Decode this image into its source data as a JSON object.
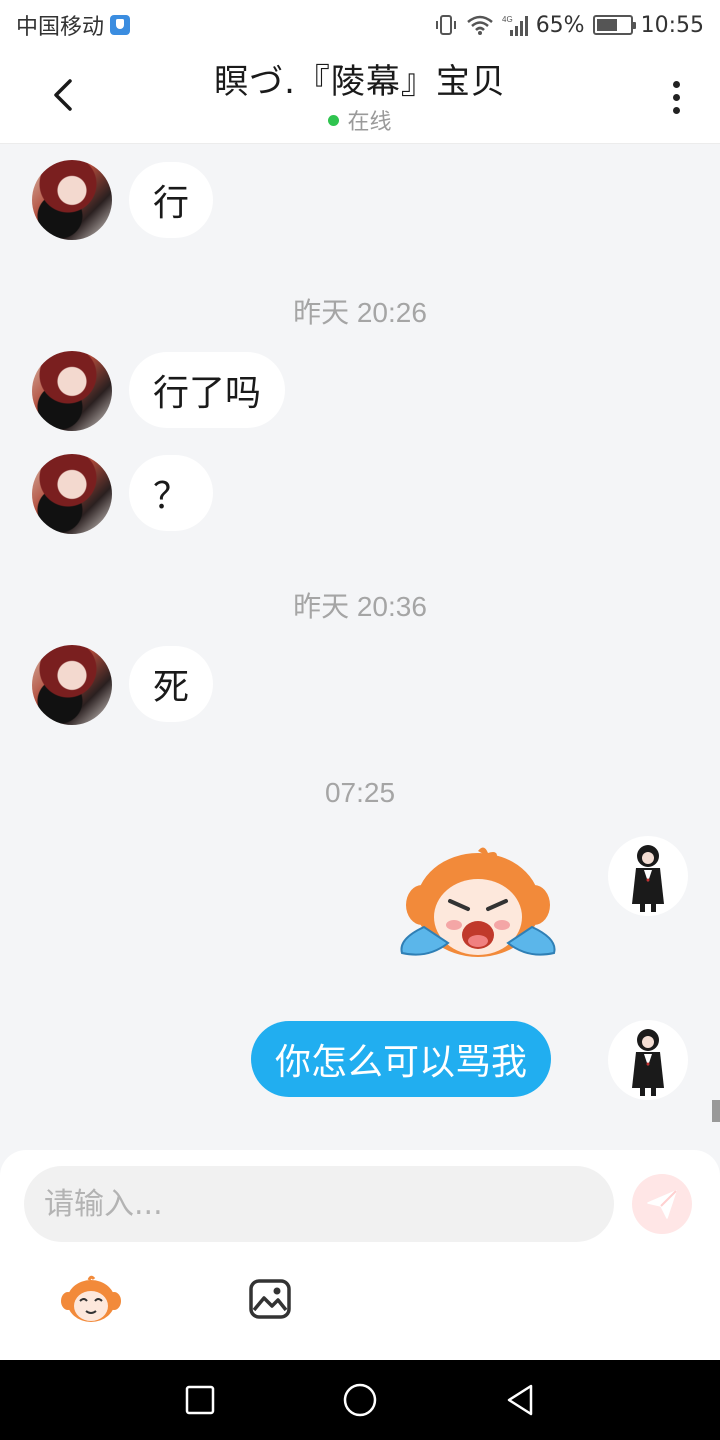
{
  "status_bar": {
    "carrier": "中国移动",
    "network": "4G",
    "battery": "65%",
    "battery_level": 0.65,
    "time": "10:55"
  },
  "header": {
    "back_icon": "chevron-left-icon",
    "title": "瞑づ.『陵幕』宝贝",
    "status": "在线",
    "status_color": "#2fc44f",
    "more_icon": "more-vertical-icon"
  },
  "messages": [
    {
      "kind": "text",
      "direction": "in",
      "text": "行"
    },
    {
      "kind": "timestamp",
      "text": "昨天 20:26"
    },
    {
      "kind": "text",
      "direction": "in",
      "text": "行了吗"
    },
    {
      "kind": "text",
      "direction": "in",
      "text": "？"
    },
    {
      "kind": "timestamp",
      "text": "昨天 20:36"
    },
    {
      "kind": "text",
      "direction": "in",
      "text": "死"
    },
    {
      "kind": "timestamp",
      "text": "07:25"
    },
    {
      "kind": "sticker",
      "direction": "out",
      "sticker": "crying-monkey-sticker"
    },
    {
      "kind": "text",
      "direction": "out",
      "text": "你怎么可以骂我"
    }
  ],
  "composer": {
    "placeholder": "请输入...",
    "send_icon": "send-icon",
    "emoji_icon": "monkey-emoji-icon",
    "image_icon": "image-icon"
  },
  "colors": {
    "outgoing_bubble": "#21aef0",
    "incoming_bubble": "#ffffff",
    "chat_background": "#f4f5f7",
    "send_button": "#ffe6e6"
  },
  "nav_bar": {
    "recent_icon": "square-icon",
    "home_icon": "circle-icon",
    "back_icon": "triangle-back-icon"
  }
}
